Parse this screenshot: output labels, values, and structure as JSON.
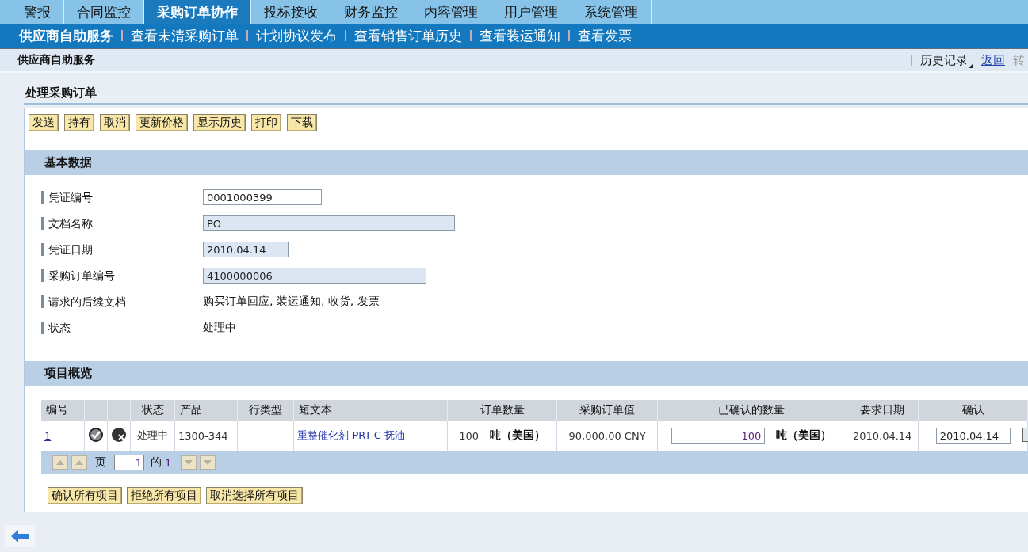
{
  "tabs": [
    {
      "label": "警报",
      "selected": false
    },
    {
      "label": "合同监控",
      "selected": false
    },
    {
      "label": "采购订单协作",
      "selected": true
    },
    {
      "label": "投标接收",
      "selected": false
    },
    {
      "label": "财务监控",
      "selected": false
    },
    {
      "label": "内容管理",
      "selected": false
    },
    {
      "label": "用户管理",
      "selected": false
    },
    {
      "label": "系统管理",
      "selected": false
    }
  ],
  "subnav": [
    {
      "label": "供应商自助服务",
      "selected": true
    },
    {
      "label": "查看未清采购订单",
      "selected": false
    },
    {
      "label": "计划协议发布",
      "selected": false
    },
    {
      "label": "查看销售订单历史",
      "selected": false
    },
    {
      "label": "查看装运通知",
      "selected": false
    },
    {
      "label": "查看发票",
      "selected": false
    }
  ],
  "breadcrumb": {
    "title": "供应商自助服务",
    "history": "历史记录",
    "back": "返回",
    "forward": {
      "label": "转",
      "disabled": true
    }
  },
  "page_title": "处理采购订单",
  "toolbar": [
    "发送",
    "持有",
    "取消",
    "更新价格",
    "显示历史",
    "打印",
    "下载"
  ],
  "basic_data": {
    "title": "基本数据",
    "fields": [
      {
        "label": "凭证编号",
        "kind": "input",
        "value": "0001000399"
      },
      {
        "label": "文档名称",
        "kind": "readonly",
        "value": "PO"
      },
      {
        "label": "凭证日期",
        "kind": "readonly",
        "value": "2010.04.14"
      },
      {
        "label": "采购订单编号",
        "kind": "readonly",
        "value": "4100000006"
      },
      {
        "label": "请求的后续文档",
        "kind": "text",
        "value": "购买订单回应, 装运通知, 收货, 发票"
      },
      {
        "label": "状态",
        "kind": "text",
        "value": "处理中"
      }
    ]
  },
  "items": {
    "title": "项目概览",
    "columns": [
      "编号",
      "",
      "",
      "状态",
      "产品",
      "行类型",
      "短文本",
      "订单数量",
      "采购订单值",
      "已确认的数量",
      "要求日期",
      "确认"
    ],
    "rows": [
      {
        "cells": [
          {
            "kind": "link",
            "text": "1"
          },
          {
            "kind": "check-icon"
          },
          {
            "kind": "reject-icon"
          },
          {
            "kind": "text",
            "text": "处理中"
          },
          {
            "kind": "text",
            "text": "1300-344"
          },
          {
            "kind": "blank"
          },
          {
            "kind": "link",
            "text": "重整催化剂  PRT-C 抚油"
          },
          {
            "kind": "qty",
            "value": "100",
            "unit": "吨（美国）"
          },
          {
            "kind": "text",
            "text": "90,000.00 CNY"
          },
          {
            "kind": "qty-input",
            "value": "100",
            "unit": "吨（美国）"
          },
          {
            "kind": "text",
            "text": "2010.04.14"
          },
          {
            "kind": "date-input",
            "value": "2010.04.14"
          }
        ]
      }
    ],
    "pager": {
      "page_label": "页",
      "page": "1",
      "of_label": "的",
      "total": "1"
    }
  },
  "actions": [
    "确认所有项目",
    "拒绝所有项目",
    "取消选择所有项目"
  ]
}
